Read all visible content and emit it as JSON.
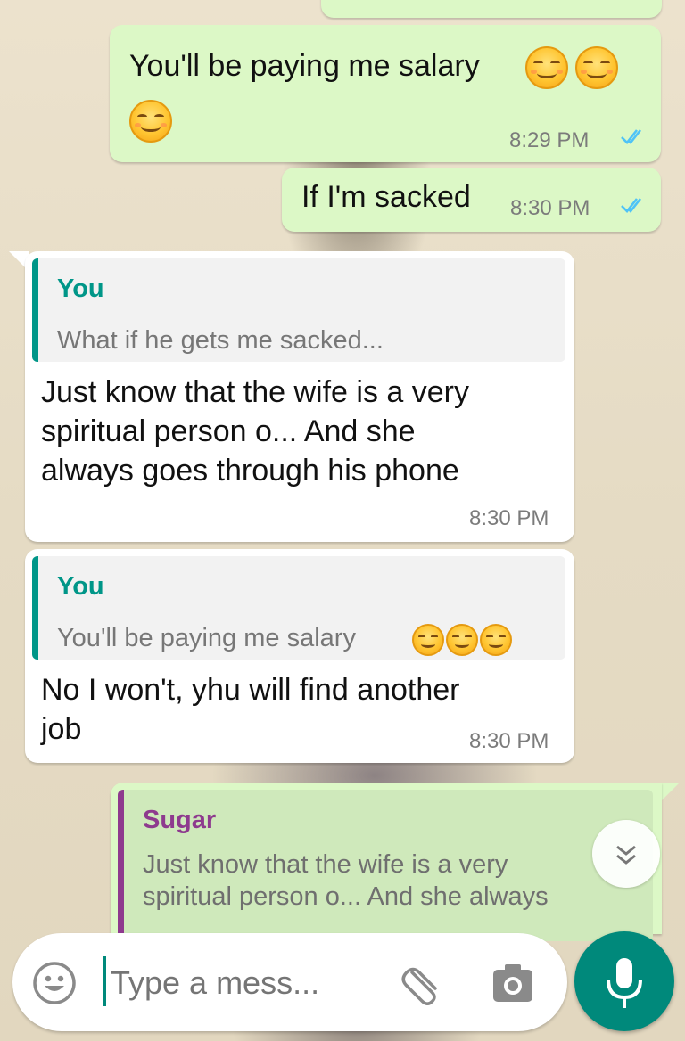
{
  "messages": {
    "m1": {
      "text": "You'll be paying me salary",
      "time": "8:29 PM",
      "status": "read"
    },
    "m2": {
      "text": "If I'm sacked",
      "time": "8:30 PM",
      "status": "read"
    },
    "m3": {
      "quote_author": "You",
      "quote_text": "What if he gets me sacked...",
      "lines": [
        "Just know that the wife is a very",
        "spiritual person o... And she",
        "always goes through his phone"
      ],
      "time": "8:30 PM"
    },
    "m4": {
      "quote_author": "You",
      "quote_text": "You'll be paying me salary",
      "lines": [
        "No I won't, yhu will find another",
        "job"
      ],
      "time": "8:30 PM"
    },
    "m5": {
      "quote_author": "Sugar",
      "quote_lines": [
        "Just know that the wife is a very",
        "spiritual person o... And she always"
      ]
    }
  },
  "input": {
    "placeholder": "Type a mess..."
  },
  "icons": {
    "emoji": "smiling-face-icon",
    "attach": "paperclip-icon",
    "camera": "camera-icon",
    "mic": "microphone-icon",
    "scroll": "double-chevron-down-icon",
    "ticks": "double-check-icon"
  },
  "colors": {
    "outgoing_bubble": "#dcf8c6",
    "incoming_bubble": "#ffffff",
    "read_ticks": "#4fc3f7",
    "quote_you": "#009688",
    "quote_sugar": "#8e3a8e",
    "mic_button": "#00897b"
  }
}
